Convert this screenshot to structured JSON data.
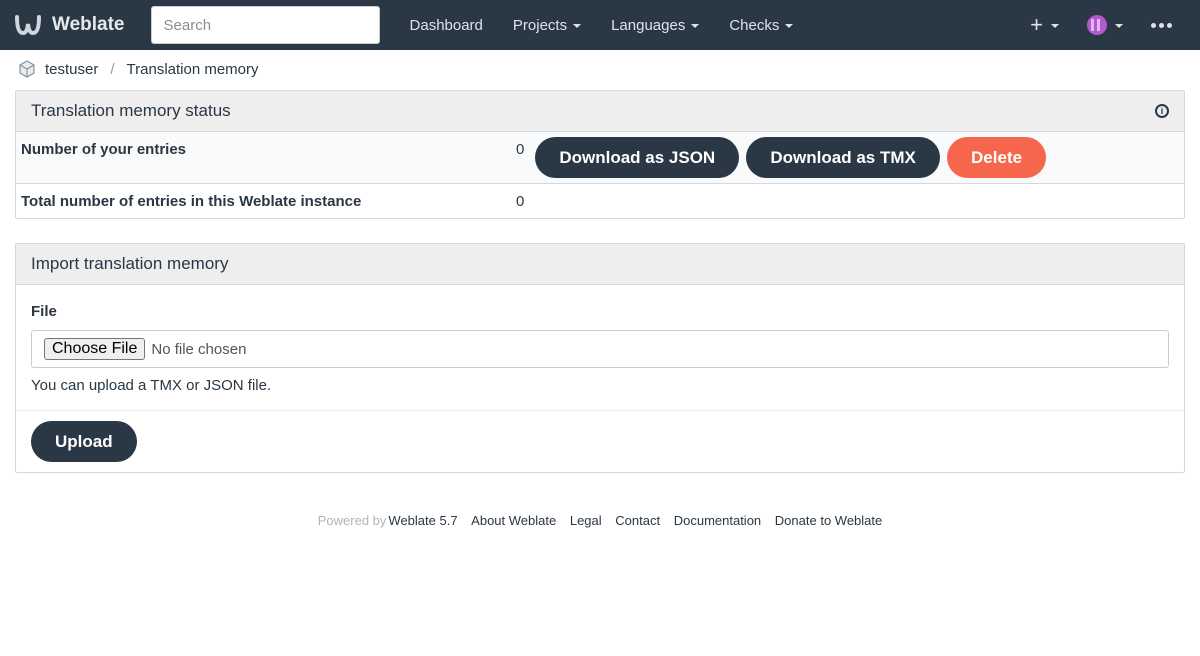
{
  "navbar": {
    "brand": "Weblate",
    "search_placeholder": "Search",
    "links": [
      "Dashboard",
      "Projects",
      "Languages",
      "Checks"
    ],
    "add_label": "+"
  },
  "breadcrumb": {
    "user": "testuser",
    "separator": "/",
    "page": "Translation memory"
  },
  "status_panel": {
    "title": "Translation memory status",
    "rows": [
      {
        "label": "Number of your entries",
        "count": "0"
      },
      {
        "label": "Total number of entries in this Weblate instance",
        "count": "0"
      }
    ],
    "buttons": {
      "download_json": "Download as JSON",
      "download_tmx": "Download as TMX",
      "delete": "Delete"
    }
  },
  "import_panel": {
    "title": "Import translation memory",
    "file_label": "File",
    "choose_file": "Choose File",
    "no_file": "No file chosen",
    "help": "You can upload a TMX or JSON file.",
    "upload": "Upload"
  },
  "footer": {
    "powered_by": "Powered by",
    "version": "Weblate 5.7",
    "links": [
      "About Weblate",
      "Legal",
      "Contact",
      "Documentation",
      "Donate to Weblate"
    ]
  },
  "colors": {
    "navbar_bg": "#2a3744",
    "danger": "#f6664c",
    "panel_heading": "#eeeeef"
  }
}
